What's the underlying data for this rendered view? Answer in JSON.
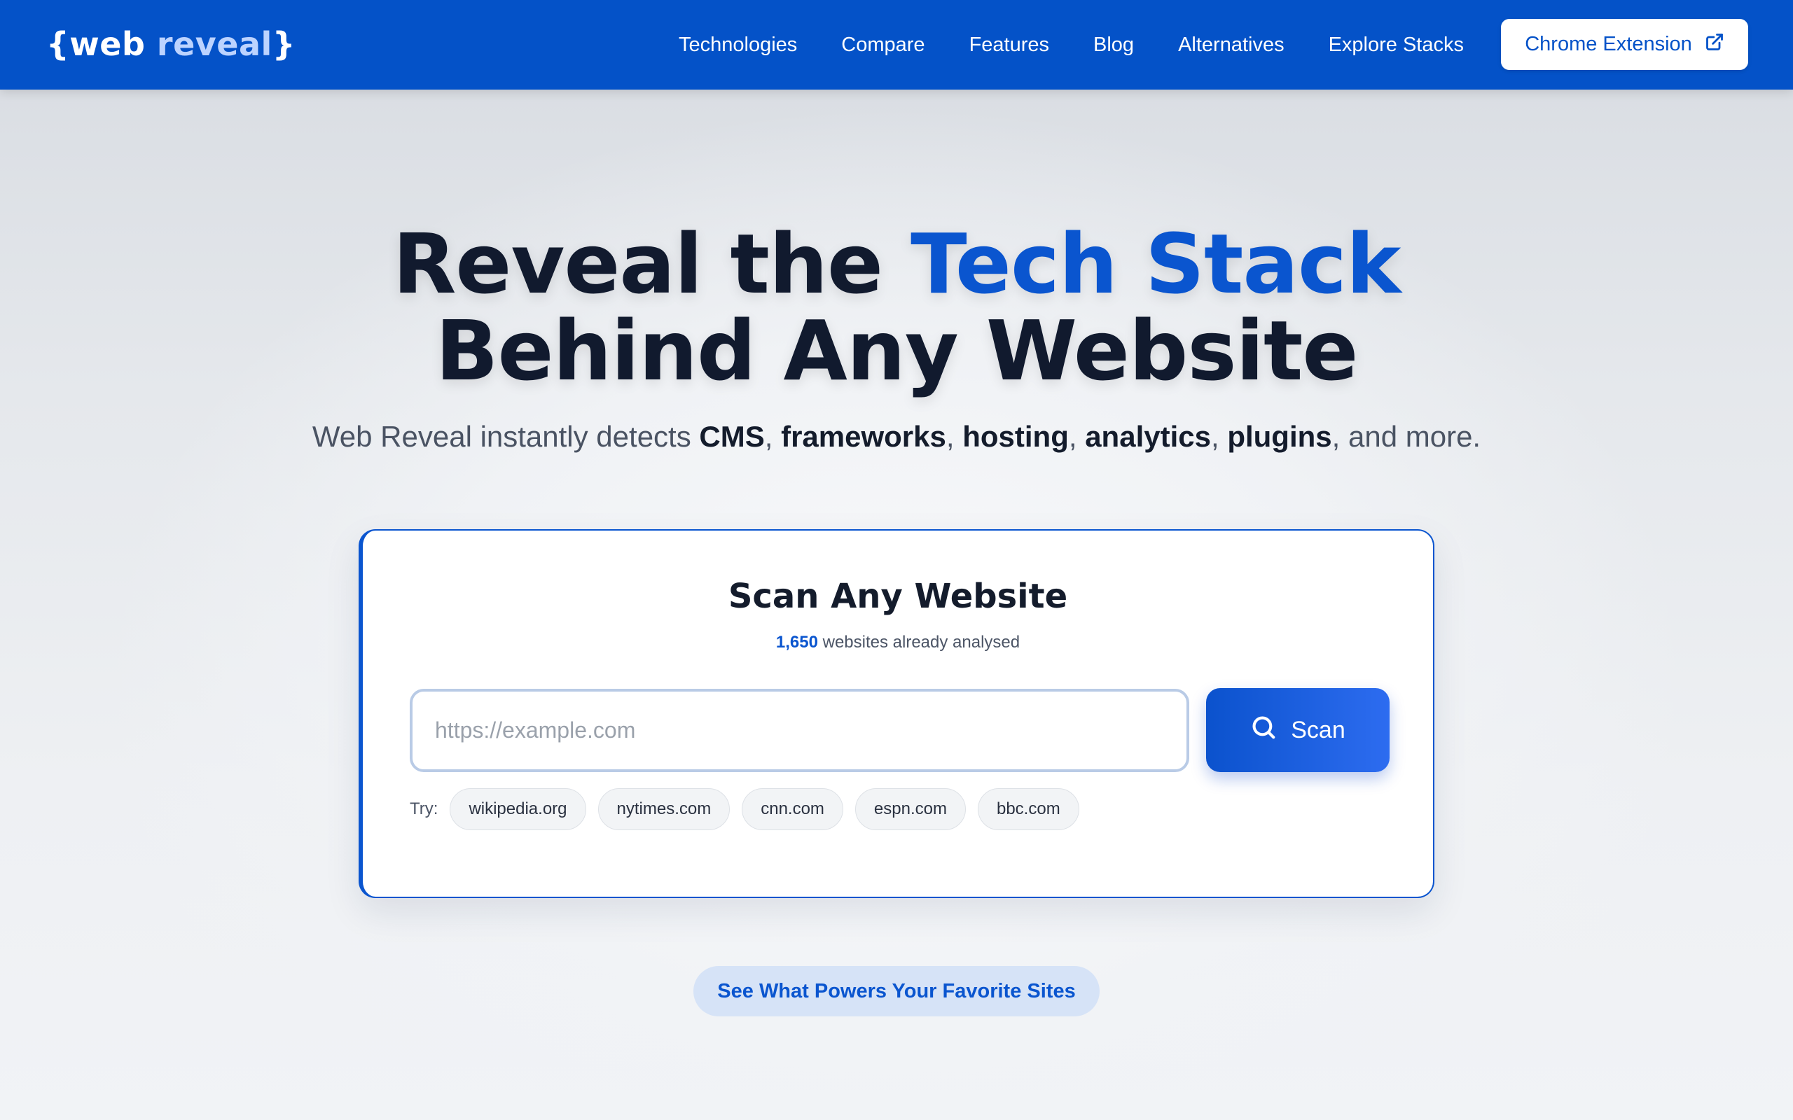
{
  "header": {
    "logo_open": "{web ",
    "logo_accent": "reveal",
    "logo_close": "}",
    "nav": [
      "Technologies",
      "Compare",
      "Features",
      "Blog",
      "Alternatives",
      "Explore Stacks"
    ],
    "extension_label": "Chrome Extension",
    "brand_color": "#0452c8"
  },
  "hero": {
    "headline_part1": "Reveal the ",
    "headline_highlight": "Tech Stack",
    "headline_line2": "Behind Any Website",
    "sub_prefix": "Web Reveal instantly detects ",
    "sub_items": [
      "CMS",
      "frameworks",
      "hosting",
      "analytics",
      "plugins"
    ],
    "sub_suffix": ", and more."
  },
  "scan_card": {
    "title": "Scan Any Website",
    "count": "1,650",
    "count_suffix": " websites already analysed",
    "input_placeholder": "https://example.com",
    "input_value": "",
    "scan_label": "Scan",
    "try_label": "Try:",
    "examples": [
      "wikipedia.org",
      "nytimes.com",
      "cnn.com",
      "espn.com",
      "bbc.com"
    ]
  },
  "cta": {
    "label": "See What Powers Your Favorite Sites"
  },
  "icons": {
    "external_link": "external-link-icon",
    "search": "search-icon"
  }
}
